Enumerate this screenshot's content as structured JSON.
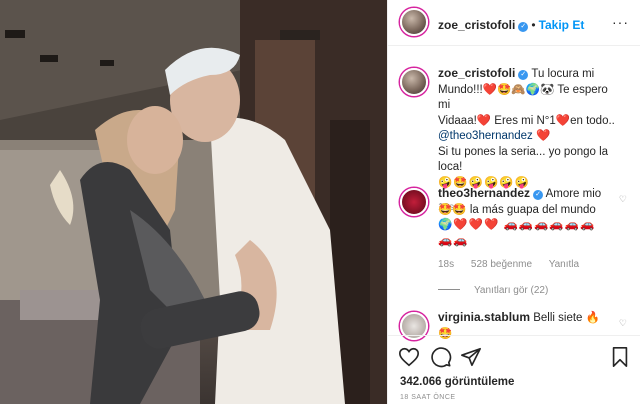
{
  "post": {
    "author": "zoe_cristofoli",
    "follow_label": "Takip Et",
    "separator": "•"
  },
  "caption": {
    "username": "zoe_cristofoli",
    "line1": "Tu locura mi",
    "line2": "Mundo!!!❤️🤩🙈🌍🐼 Te espero mi",
    "line3": "Vidaaa!❤️ Eres mi N°1❤️en todo..",
    "mention": "@theo3hernandez",
    "line4": "Si tu pones la seria... yo pongo la loca!",
    "line5": "🤪🤩🤪🤪🤪🤪",
    "time": "18s"
  },
  "comments": [
    {
      "username": "theo3hernandez",
      "text1": "Amore mio",
      "text2": "🤩🤩 la más guapa del mundo",
      "text3": "🌍❤️❤️❤️ 🚗🚗🚗🚗🚗🚗",
      "text4": "🚗🚗",
      "time": "18s",
      "likes": "528 beğenme",
      "reply": "Yanıtla",
      "view_replies": "Yanıtları gör (22)"
    },
    {
      "username": "virginia.stablum",
      "text1": "Belli siete 🔥",
      "text2": "🤩"
    }
  ],
  "footer": {
    "views": "342.066 görüntüleme",
    "timestamp": "18 SAAT ÖNCE"
  },
  "icons": {
    "like": "heart-icon",
    "comment": "comment-icon",
    "share": "share-icon",
    "save": "bookmark-icon"
  },
  "colors": {
    "follow": "#0095f6",
    "verified": "#3897f0",
    "heart": "#ed1c24"
  }
}
